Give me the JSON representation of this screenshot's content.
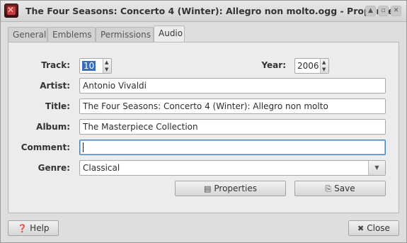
{
  "window": {
    "title": "The Four Seasons: Concerto 4 (Winter): Allegro non molto.ogg - Properties",
    "controls": [
      "up-icon",
      "maximize-icon",
      "close-icon"
    ]
  },
  "tabs": [
    {
      "label": "General",
      "active": false
    },
    {
      "label": "Emblems",
      "active": false
    },
    {
      "label": "Permissions",
      "active": false
    },
    {
      "label": "Audio",
      "active": true
    }
  ],
  "audio": {
    "track_label": "Track:",
    "track_value": "10",
    "year_label": "Year:",
    "year_value": "2006",
    "artist_label": "Artist:",
    "artist_value": "Antonio Vivaldi",
    "title_label": "Title:",
    "title_value": "The Four Seasons: Concerto 4 (Winter): Allegro non molto",
    "album_label": "Album:",
    "album_value": "The Masterpiece Collection",
    "comment_label": "Comment:",
    "comment_value": "",
    "genre_label": "Genre:",
    "genre_value": "Classical",
    "properties_button": "Properties",
    "save_button": "Save"
  },
  "footer": {
    "help_button": "Help",
    "close_button": "Close"
  }
}
